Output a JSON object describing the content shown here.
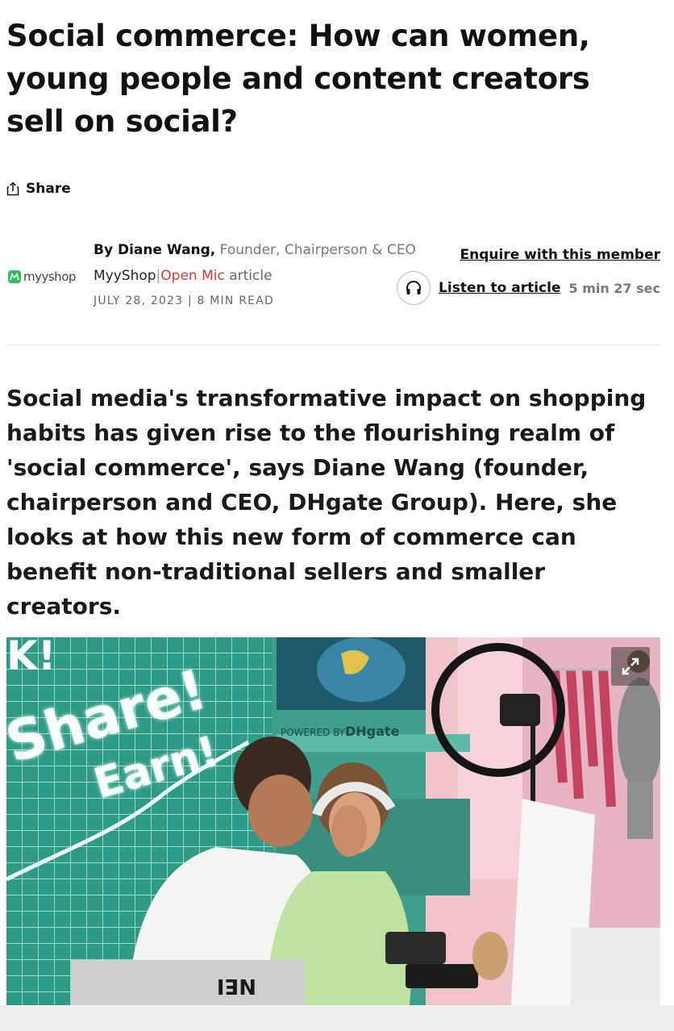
{
  "article": {
    "title": "Social commerce: How can women, young people and content creators sell on social?",
    "share_label": "Share",
    "standfirst": "Social media's transformative impact on shopping habits has given rise to the flourishing realm of 'social commerce', says Diane Wang (founder, chairperson and CEO, DHgate Group). Here, she looks at how this new form of commerce can benefit non-traditional sellers and smaller creators."
  },
  "byline": {
    "logo_text": "myyshop",
    "by": "By Diane Wang,",
    "role": "Founder, Chairperson & CEO",
    "publisher": "MyyShop",
    "separator": "|",
    "section": "Open Mic",
    "type": "article",
    "date": "JULY 28, 2023",
    "read_time": "8 MIN READ"
  },
  "actions": {
    "enquire_label": "Enquire with this member",
    "listen_label": "Listen to article",
    "listen_duration": "5 min 27 sec"
  },
  "hero": {
    "neon_line1": "Share!",
    "neon_line2": "Earn!",
    "neon_fragment": "K!",
    "booth_text": "POWERED BY",
    "booth_brand": "DHgate",
    "laptop_sticker": "NEI"
  },
  "icons": {
    "share": "share-icon",
    "headphones": "headphones-icon",
    "expand": "expand-icon"
  },
  "colors": {
    "accent_red": "#d9372f",
    "logo_green": "#2bbf5a",
    "tile_green": "#2f9a86"
  }
}
